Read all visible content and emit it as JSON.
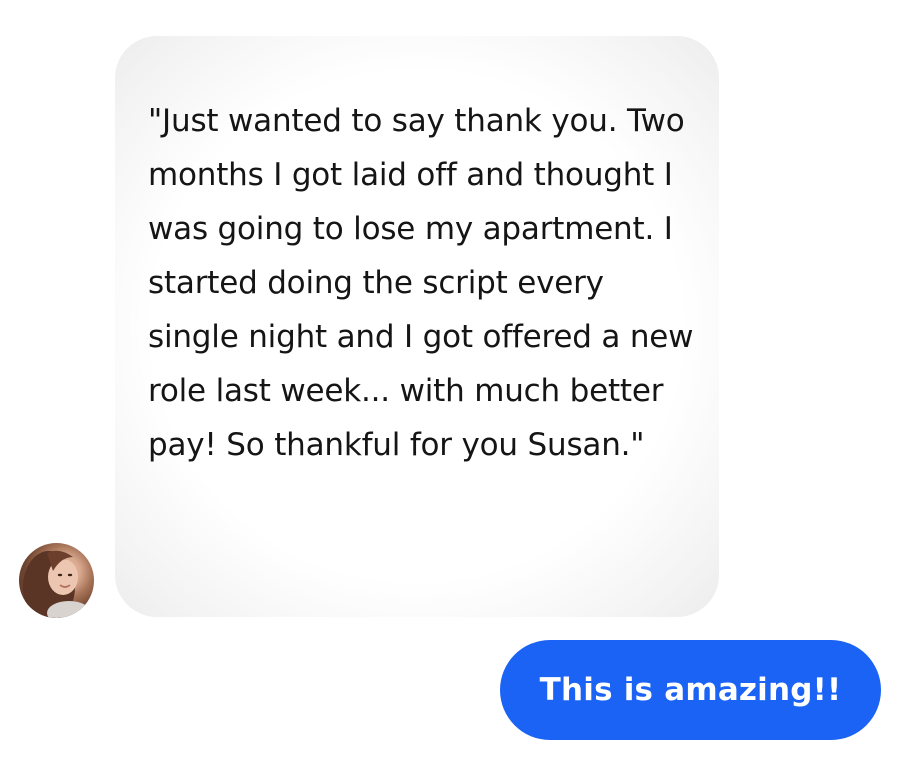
{
  "conversation": {
    "incoming": {
      "text": "\"Just wanted to say thank you. Two months I got laid off and thought I was going to lose my apartment. I started doing the script every single night and I got offered a new role last week... with much better pay! So thankful for you Susan.\"",
      "avatar_icon": "user-avatar-photo"
    },
    "outgoing": {
      "text": "This is amazing!!"
    }
  },
  "colors": {
    "incoming_bubble": "#f3f3f3",
    "outgoing_bubble": "#1b63f4",
    "incoming_text": "#151515",
    "outgoing_text": "#ffffff"
  }
}
